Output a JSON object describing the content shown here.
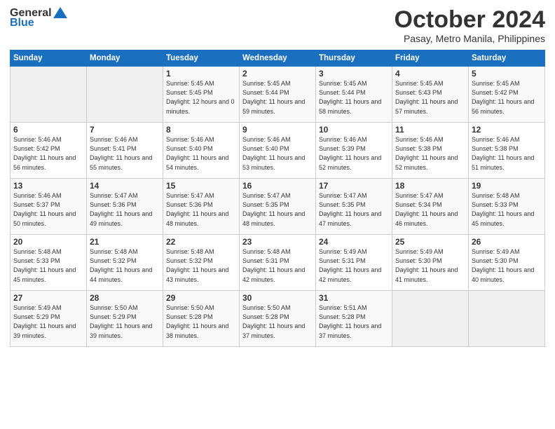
{
  "logo": {
    "general": "General",
    "blue": "Blue"
  },
  "header": {
    "month": "October 2024",
    "location": "Pasay, Metro Manila, Philippines"
  },
  "weekdays": [
    "Sunday",
    "Monday",
    "Tuesday",
    "Wednesday",
    "Thursday",
    "Friday",
    "Saturday"
  ],
  "weeks": [
    [
      {
        "day": "",
        "sunrise": "",
        "sunset": "",
        "daylight": ""
      },
      {
        "day": "",
        "sunrise": "",
        "sunset": "",
        "daylight": ""
      },
      {
        "day": "1",
        "sunrise": "Sunrise: 5:45 AM",
        "sunset": "Sunset: 5:45 PM",
        "daylight": "Daylight: 12 hours and 0 minutes."
      },
      {
        "day": "2",
        "sunrise": "Sunrise: 5:45 AM",
        "sunset": "Sunset: 5:44 PM",
        "daylight": "Daylight: 11 hours and 59 minutes."
      },
      {
        "day": "3",
        "sunrise": "Sunrise: 5:45 AM",
        "sunset": "Sunset: 5:44 PM",
        "daylight": "Daylight: 11 hours and 58 minutes."
      },
      {
        "day": "4",
        "sunrise": "Sunrise: 5:45 AM",
        "sunset": "Sunset: 5:43 PM",
        "daylight": "Daylight: 11 hours and 57 minutes."
      },
      {
        "day": "5",
        "sunrise": "Sunrise: 5:45 AM",
        "sunset": "Sunset: 5:42 PM",
        "daylight": "Daylight: 11 hours and 56 minutes."
      }
    ],
    [
      {
        "day": "6",
        "sunrise": "Sunrise: 5:46 AM",
        "sunset": "Sunset: 5:42 PM",
        "daylight": "Daylight: 11 hours and 56 minutes."
      },
      {
        "day": "7",
        "sunrise": "Sunrise: 5:46 AM",
        "sunset": "Sunset: 5:41 PM",
        "daylight": "Daylight: 11 hours and 55 minutes."
      },
      {
        "day": "8",
        "sunrise": "Sunrise: 5:46 AM",
        "sunset": "Sunset: 5:40 PM",
        "daylight": "Daylight: 11 hours and 54 minutes."
      },
      {
        "day": "9",
        "sunrise": "Sunrise: 5:46 AM",
        "sunset": "Sunset: 5:40 PM",
        "daylight": "Daylight: 11 hours and 53 minutes."
      },
      {
        "day": "10",
        "sunrise": "Sunrise: 5:46 AM",
        "sunset": "Sunset: 5:39 PM",
        "daylight": "Daylight: 11 hours and 52 minutes."
      },
      {
        "day": "11",
        "sunrise": "Sunrise: 5:46 AM",
        "sunset": "Sunset: 5:38 PM",
        "daylight": "Daylight: 11 hours and 52 minutes."
      },
      {
        "day": "12",
        "sunrise": "Sunrise: 5:46 AM",
        "sunset": "Sunset: 5:38 PM",
        "daylight": "Daylight: 11 hours and 51 minutes."
      }
    ],
    [
      {
        "day": "13",
        "sunrise": "Sunrise: 5:46 AM",
        "sunset": "Sunset: 5:37 PM",
        "daylight": "Daylight: 11 hours and 50 minutes."
      },
      {
        "day": "14",
        "sunrise": "Sunrise: 5:47 AM",
        "sunset": "Sunset: 5:36 PM",
        "daylight": "Daylight: 11 hours and 49 minutes."
      },
      {
        "day": "15",
        "sunrise": "Sunrise: 5:47 AM",
        "sunset": "Sunset: 5:36 PM",
        "daylight": "Daylight: 11 hours and 48 minutes."
      },
      {
        "day": "16",
        "sunrise": "Sunrise: 5:47 AM",
        "sunset": "Sunset: 5:35 PM",
        "daylight": "Daylight: 11 hours and 48 minutes."
      },
      {
        "day": "17",
        "sunrise": "Sunrise: 5:47 AM",
        "sunset": "Sunset: 5:35 PM",
        "daylight": "Daylight: 11 hours and 47 minutes."
      },
      {
        "day": "18",
        "sunrise": "Sunrise: 5:47 AM",
        "sunset": "Sunset: 5:34 PM",
        "daylight": "Daylight: 11 hours and 46 minutes."
      },
      {
        "day": "19",
        "sunrise": "Sunrise: 5:48 AM",
        "sunset": "Sunset: 5:33 PM",
        "daylight": "Daylight: 11 hours and 45 minutes."
      }
    ],
    [
      {
        "day": "20",
        "sunrise": "Sunrise: 5:48 AM",
        "sunset": "Sunset: 5:33 PM",
        "daylight": "Daylight: 11 hours and 45 minutes."
      },
      {
        "day": "21",
        "sunrise": "Sunrise: 5:48 AM",
        "sunset": "Sunset: 5:32 PM",
        "daylight": "Daylight: 11 hours and 44 minutes."
      },
      {
        "day": "22",
        "sunrise": "Sunrise: 5:48 AM",
        "sunset": "Sunset: 5:32 PM",
        "daylight": "Daylight: 11 hours and 43 minutes."
      },
      {
        "day": "23",
        "sunrise": "Sunrise: 5:48 AM",
        "sunset": "Sunset: 5:31 PM",
        "daylight": "Daylight: 11 hours and 42 minutes."
      },
      {
        "day": "24",
        "sunrise": "Sunrise: 5:49 AM",
        "sunset": "Sunset: 5:31 PM",
        "daylight": "Daylight: 11 hours and 42 minutes."
      },
      {
        "day": "25",
        "sunrise": "Sunrise: 5:49 AM",
        "sunset": "Sunset: 5:30 PM",
        "daylight": "Daylight: 11 hours and 41 minutes."
      },
      {
        "day": "26",
        "sunrise": "Sunrise: 5:49 AM",
        "sunset": "Sunset: 5:30 PM",
        "daylight": "Daylight: 11 hours and 40 minutes."
      }
    ],
    [
      {
        "day": "27",
        "sunrise": "Sunrise: 5:49 AM",
        "sunset": "Sunset: 5:29 PM",
        "daylight": "Daylight: 11 hours and 39 minutes."
      },
      {
        "day": "28",
        "sunrise": "Sunrise: 5:50 AM",
        "sunset": "Sunset: 5:29 PM",
        "daylight": "Daylight: 11 hours and 39 minutes."
      },
      {
        "day": "29",
        "sunrise": "Sunrise: 5:50 AM",
        "sunset": "Sunset: 5:28 PM",
        "daylight": "Daylight: 11 hours and 38 minutes."
      },
      {
        "day": "30",
        "sunrise": "Sunrise: 5:50 AM",
        "sunset": "Sunset: 5:28 PM",
        "daylight": "Daylight: 11 hours and 37 minutes."
      },
      {
        "day": "31",
        "sunrise": "Sunrise: 5:51 AM",
        "sunset": "Sunset: 5:28 PM",
        "daylight": "Daylight: 11 hours and 37 minutes."
      },
      {
        "day": "",
        "sunrise": "",
        "sunset": "",
        "daylight": ""
      },
      {
        "day": "",
        "sunrise": "",
        "sunset": "",
        "daylight": ""
      }
    ]
  ]
}
